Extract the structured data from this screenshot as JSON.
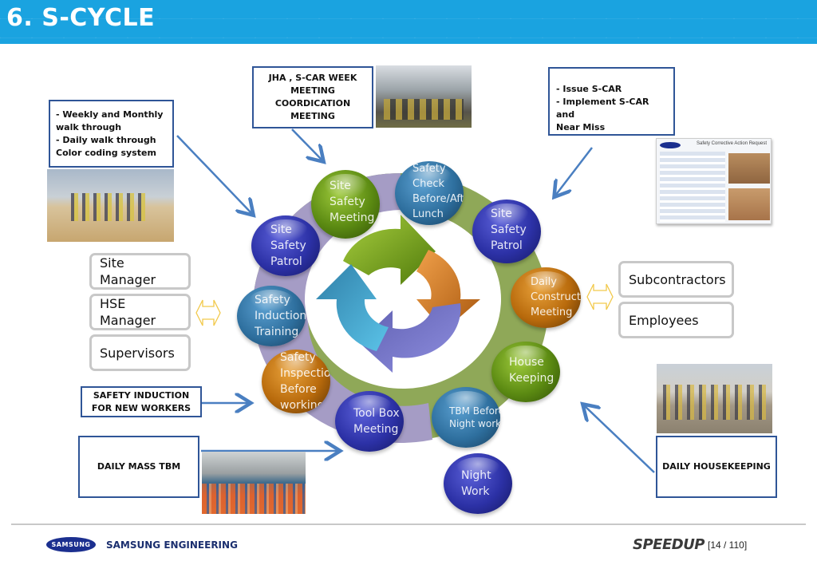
{
  "header": {
    "title": "6. S-CYCLE"
  },
  "callouts": {
    "walkthrough": [
      "- Weekly and Monthly",
      "walk through",
      "- Daily walk through",
      "Color coding system"
    ],
    "jha": [
      "JHA , S-CAR WEEK",
      "MEETING",
      "COORDICATION",
      "MEETING"
    ],
    "scar": [
      "- Issue S-CAR",
      "- Implement S-CAR and",
      "Near Miss"
    ],
    "safety_induction": [
      "SAFETY INDUCTION",
      "FOR NEW WORKERS"
    ],
    "daily_mass_tbm": "DAILY MASS TBM",
    "daily_housekeeping": "DAILY HOUSEKEEPING"
  },
  "roles_left": [
    {
      "label": "Site\nManager"
    },
    {
      "label": "HSE\nManager"
    },
    {
      "label": "Supervisors"
    }
  ],
  "roles_right": [
    {
      "label": "Subcontractors"
    },
    {
      "label": "Employees"
    }
  ],
  "cycle_items": [
    {
      "label": "Site\nSafety\nMeeting",
      "color": "green"
    },
    {
      "label": "Safety\nCheck\nBefore/After\nLunch",
      "color": "blue"
    },
    {
      "label": "Site\nSafety\nPatrol",
      "color": "navy"
    },
    {
      "label": "Daily\nConstruct\nMeeting",
      "color": "orange"
    },
    {
      "label": "House\nKeeping",
      "color": "green"
    },
    {
      "label": "TBM Before\nNight work",
      "color": "blue"
    },
    {
      "label": "Night\nWork",
      "color": "navy"
    },
    {
      "label": "Tool Box\nMeeting",
      "color": "navy"
    },
    {
      "label": "Safety\nInspection\nBefore\nworking",
      "color": "orange"
    },
    {
      "label": "Safety\nInduction\nTraining",
      "color": "blue"
    },
    {
      "label": "Site\nSafety\nPatrol",
      "color": "navy"
    }
  ],
  "scar_form": {
    "title": "Safety Corrective Action Request"
  },
  "footer": {
    "logo_text": "SAMSUNG",
    "company": "SAMSUNG ENGINEERING",
    "brand": "SPEEDUP",
    "page": "[14 / 110]"
  },
  "colors": {
    "header_bg": "#1aa3e0",
    "box_border": "#2f5597",
    "arrow": "#4a7fc1",
    "ring_purple": "#a59cc5",
    "ring_green": "#8fa858",
    "double_arrow": "#f2c94c"
  }
}
